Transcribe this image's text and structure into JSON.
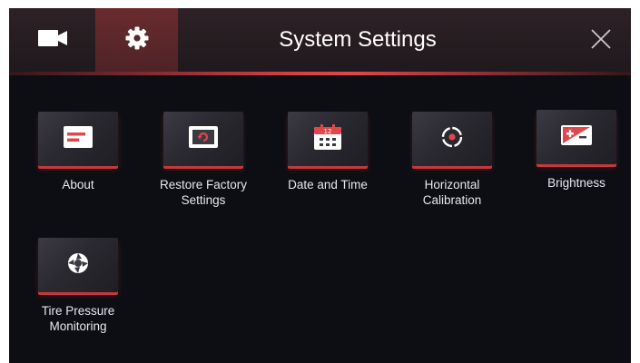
{
  "header": {
    "title": "System Settings",
    "tabs": [
      {
        "icon": "video-camera-icon"
      },
      {
        "icon": "gear-icon",
        "active": true
      }
    ],
    "close_icon": "close-icon"
  },
  "menu": {
    "items": [
      {
        "label": "About",
        "icon": "about-card-icon"
      },
      {
        "label": "Restore Factory\nSettings",
        "icon": "restore-factory-icon"
      },
      {
        "label": "Date and Time",
        "icon": "calendar-icon"
      },
      {
        "label": "Horizontal\nCalibration",
        "icon": "calibration-target-icon"
      },
      {
        "label": "Brightness",
        "icon": "brightness-icon"
      },
      {
        "label": "Tire Pressure\nMonitoring",
        "icon": "tire-pressure-icon"
      }
    ]
  },
  "colors": {
    "background": "#0d0e13",
    "header": "#2a1f23",
    "active_tab": "#5e282b",
    "accent": "#e0474b",
    "text": "#ffffff"
  }
}
